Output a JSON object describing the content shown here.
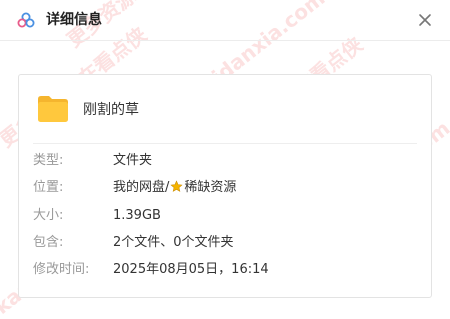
{
  "dialog": {
    "title": "详细信息",
    "close_icon": "close-icon",
    "logo_icon": "app-logo-icon"
  },
  "file": {
    "name": "刚割的草",
    "icon": "folder-icon",
    "details": [
      {
        "label": "类型:",
        "value": "文件夹"
      },
      {
        "label": "位置:",
        "value_prefix": "我的网盘/",
        "value_icon": "star-icon",
        "value_suffix": "稀缺资源"
      },
      {
        "label": "大小:",
        "value": "1.39GB"
      },
      {
        "label": "包含:",
        "value": "2个文件、0个文件夹"
      },
      {
        "label": "修改时间:",
        "value": "2025年08月05日，16:14"
      }
    ]
  },
  "watermark": {
    "site": "kanidanxia.com",
    "tagline": "更多资源尽在看点侠"
  },
  "colors": {
    "folder": "#FFC83D",
    "star": "#F5B400",
    "watermark": "#F05A5A",
    "logo_blue": "#4A90E2"
  }
}
